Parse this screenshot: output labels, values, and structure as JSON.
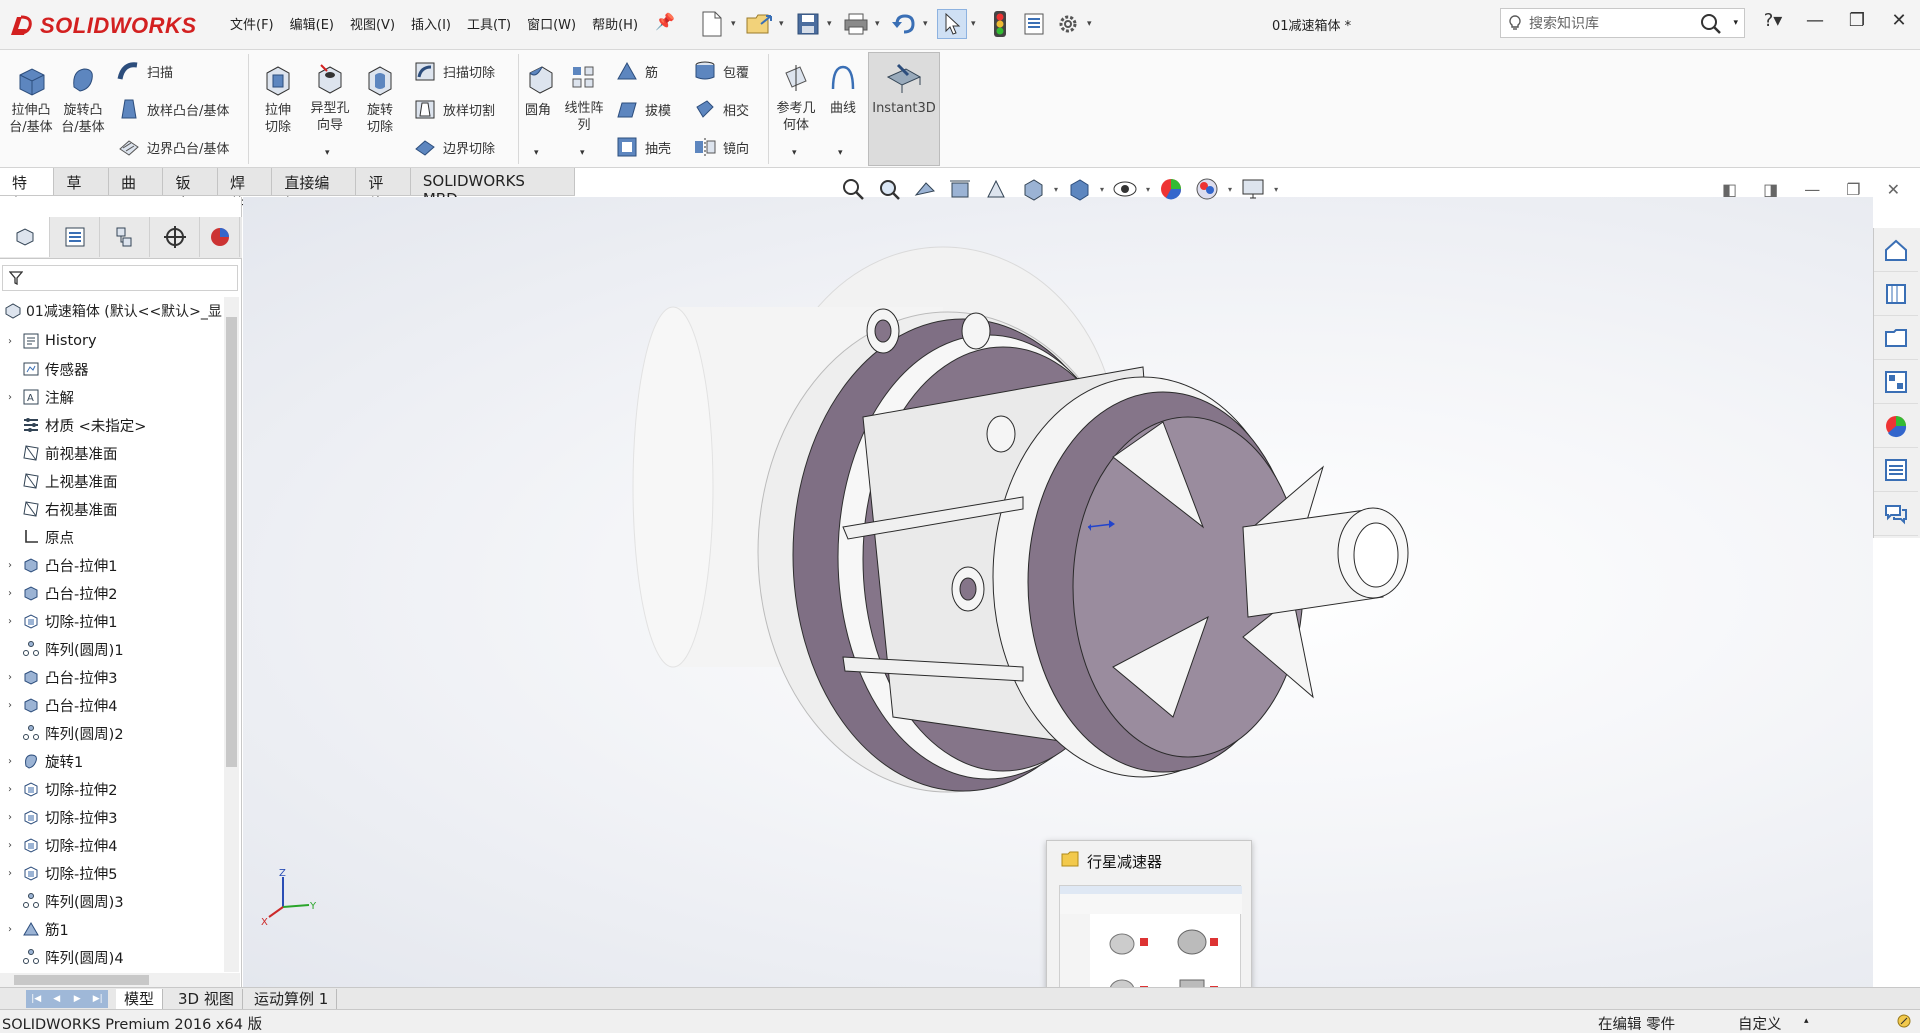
{
  "app": {
    "brand": "SOLIDWORKS",
    "document_title": "01减速箱体 *"
  },
  "menu": [
    "文件(F)",
    "编辑(E)",
    "视图(V)",
    "插入(I)",
    "工具(T)",
    "窗口(W)",
    "帮助(H)"
  ],
  "search": {
    "placeholder": "搜索知识库"
  },
  "ribbon": {
    "extrude_boss": "拉伸凸台/基体",
    "revolve_boss": "旋转凸台/基体",
    "sweep": "扫描",
    "loft_boss": "放样凸台/基体",
    "boundary_boss": "边界凸台/基体",
    "extrude_cut": "拉伸切除",
    "hole_wizard": "异型孔向导",
    "revolve_cut": "旋转切除",
    "sweep_cut": "扫描切除",
    "loft_cut": "放样切割",
    "boundary_cut": "边界切除",
    "fillet": "圆角",
    "linear_pattern": "线性阵列",
    "rib": "筋",
    "draft": "拔模",
    "shell": "抽壳",
    "wrap": "包覆",
    "intersect": "相交",
    "mirror": "镜向",
    "ref_geometry": "参考几何体",
    "curves": "曲线",
    "instant3d": "Instant3D"
  },
  "command_tabs": [
    "特征",
    "草图",
    "曲面",
    "钣金",
    "焊件",
    "直接编辑",
    "评估",
    "SOLIDWORKS MBD"
  ],
  "tree": {
    "root": "01减速箱体 (默认<<默认>_显",
    "items": [
      {
        "label": "History",
        "arrow": "›",
        "icon": "history-icon"
      },
      {
        "label": "传感器",
        "arrow": "",
        "icon": "sensor-icon"
      },
      {
        "label": "注解",
        "arrow": "›",
        "icon": "annotation-icon"
      },
      {
        "label": "材质 <未指定>",
        "arrow": "",
        "icon": "material-icon"
      },
      {
        "label": "前视基准面",
        "arrow": "",
        "icon": "plane-icon"
      },
      {
        "label": "上视基准面",
        "arrow": "",
        "icon": "plane-icon"
      },
      {
        "label": "右视基准面",
        "arrow": "",
        "icon": "plane-icon"
      },
      {
        "label": "原点",
        "arrow": "",
        "icon": "origin-icon"
      },
      {
        "label": "凸台-拉伸1",
        "arrow": "›",
        "icon": "extrude-icon"
      },
      {
        "label": "凸台-拉伸2",
        "arrow": "›",
        "icon": "extrude-icon"
      },
      {
        "label": "切除-拉伸1",
        "arrow": "›",
        "icon": "cut-icon"
      },
      {
        "label": "阵列(圆周)1",
        "arrow": "",
        "icon": "pattern-icon"
      },
      {
        "label": "凸台-拉伸3",
        "arrow": "›",
        "icon": "extrude-icon"
      },
      {
        "label": "凸台-拉伸4",
        "arrow": "›",
        "icon": "extrude-icon"
      },
      {
        "label": "阵列(圆周)2",
        "arrow": "",
        "icon": "pattern-icon"
      },
      {
        "label": "旋转1",
        "arrow": "›",
        "icon": "revolve-icon"
      },
      {
        "label": "切除-拉伸2",
        "arrow": "›",
        "icon": "cut-icon"
      },
      {
        "label": "切除-拉伸3",
        "arrow": "›",
        "icon": "cut-icon"
      },
      {
        "label": "切除-拉伸4",
        "arrow": "›",
        "icon": "cut-icon"
      },
      {
        "label": "切除-拉伸5",
        "arrow": "›",
        "icon": "cut-icon"
      },
      {
        "label": "阵列(圆周)3",
        "arrow": "",
        "icon": "pattern-icon"
      },
      {
        "label": "筋1",
        "arrow": "›",
        "icon": "rib-icon"
      },
      {
        "label": "阵列(圆周)4",
        "arrow": "",
        "icon": "pattern-icon"
      }
    ]
  },
  "popup": {
    "title": "行星减速器"
  },
  "bottom_tabs": [
    "模型",
    "3D 视图",
    "运动算例 1"
  ],
  "triad": {
    "z": "Z",
    "y": "Y",
    "x": "X"
  },
  "status": {
    "left": "SOLIDWORKS Premium 2016 x64 版",
    "mode": "在编辑 零件",
    "custom": "自定义"
  },
  "colors": {
    "brand_red": "#d32020",
    "face_purple": "#847487",
    "accent_blue": "#3a6fb5"
  }
}
